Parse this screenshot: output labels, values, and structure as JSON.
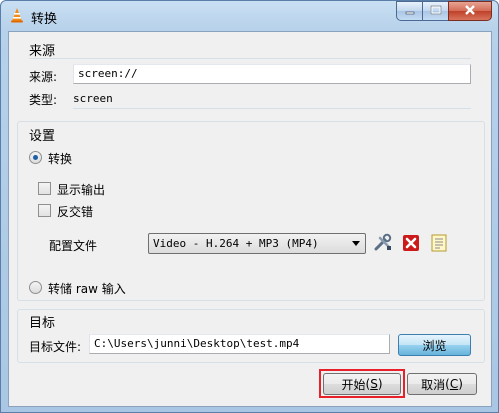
{
  "window": {
    "title": "转换"
  },
  "source_group": {
    "title": "来源",
    "source_label": "来源:",
    "source_value": "screen://",
    "type_label": "类型:",
    "type_value": "screen"
  },
  "settings_group": {
    "title": "设置",
    "convert_radio_label": "转换",
    "convert_selected": true,
    "display_output_label": "显示输出",
    "display_output_checked": false,
    "deinterlace_label": "反交错",
    "deinterlace_checked": false,
    "profile_label": "配置文件",
    "profile_value": "Video - H.264 + MP3 (MP4)",
    "dump_raw_label": "转储 raw 输入",
    "dump_raw_selected": false
  },
  "destination_group": {
    "title": "目标",
    "dest_label": "目标文件:",
    "dest_value": "C:\\Users\\junni\\Desktop\\test.mp4",
    "browse_label": "浏览"
  },
  "footer": {
    "start_label": "开始",
    "start_mnemonic": "S",
    "cancel_label": "取消",
    "cancel_mnemonic": "C"
  },
  "colors": {
    "highlight": "#e8202a",
    "accent": "#3c7fb1"
  },
  "icons": [
    "vlc-cone-icon",
    "minimize-icon",
    "maximize-icon",
    "close-icon",
    "wrench-icon",
    "delete-icon",
    "new-profile-icon"
  ]
}
